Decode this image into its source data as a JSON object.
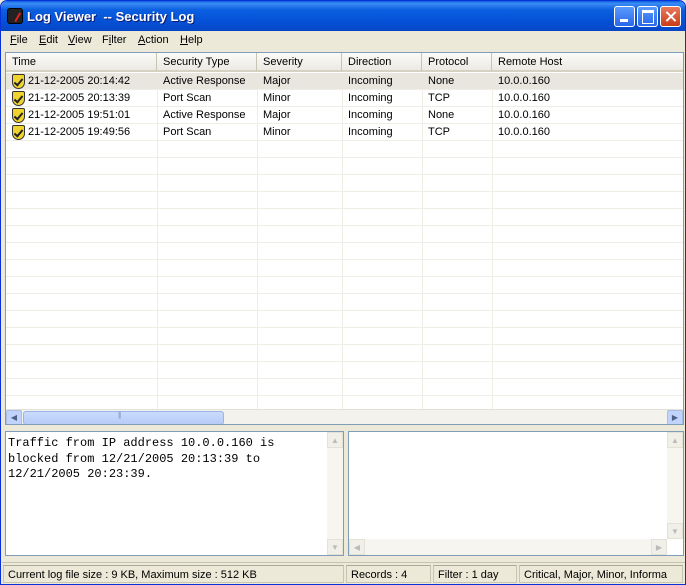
{
  "window": {
    "title": "Log Viewer  -- Security Log"
  },
  "menu": [
    {
      "u": "F",
      "rest": "ile"
    },
    {
      "u": "E",
      "rest": "dit"
    },
    {
      "u": "V",
      "rest": "iew"
    },
    {
      "pre": "F",
      "u": "i",
      "rest": "lter"
    },
    {
      "u": "A",
      "rest": "ction"
    },
    {
      "u": "H",
      "rest": "elp"
    }
  ],
  "columns": [
    "Time",
    "Security Type",
    "Severity",
    "Direction",
    "Protocol",
    "Remote Host"
  ],
  "rows": [
    {
      "time": "21-12-2005 20:14:42",
      "security_type": "Active Response",
      "severity": "Major",
      "direction": "Incoming",
      "protocol": "None",
      "remote_host": "10.0.0.160"
    },
    {
      "time": "21-12-2005 20:13:39",
      "security_type": "Port Scan",
      "severity": "Minor",
      "direction": "Incoming",
      "protocol": "TCP",
      "remote_host": "10.0.0.160"
    },
    {
      "time": "21-12-2005 19:51:01",
      "security_type": "Active Response",
      "severity": "Major",
      "direction": "Incoming",
      "protocol": "None",
      "remote_host": "10.0.0.160"
    },
    {
      "time": "21-12-2005 19:49:56",
      "security_type": "Port Scan",
      "severity": "Minor",
      "direction": "Incoming",
      "protocol": "TCP",
      "remote_host": "10.0.0.160"
    }
  ],
  "detail": {
    "text": "Traffic from IP address 10.0.0.160 is blocked from 12/21/2005 20:13:39 to 12/21/2005 20:23:39."
  },
  "status": {
    "log_size": "Current log file size : 9 KB, Maximum size : 512 KB",
    "records": "Records : 4",
    "filter": "Filter : 1 day",
    "severities": "Critical, Major, Minor, Informa"
  },
  "colors": {
    "titlebar": "#0a5fdf",
    "selected_row": "#e8e6df",
    "shield": "#efd430"
  },
  "icons": {
    "row_icon": "shield-icon"
  }
}
